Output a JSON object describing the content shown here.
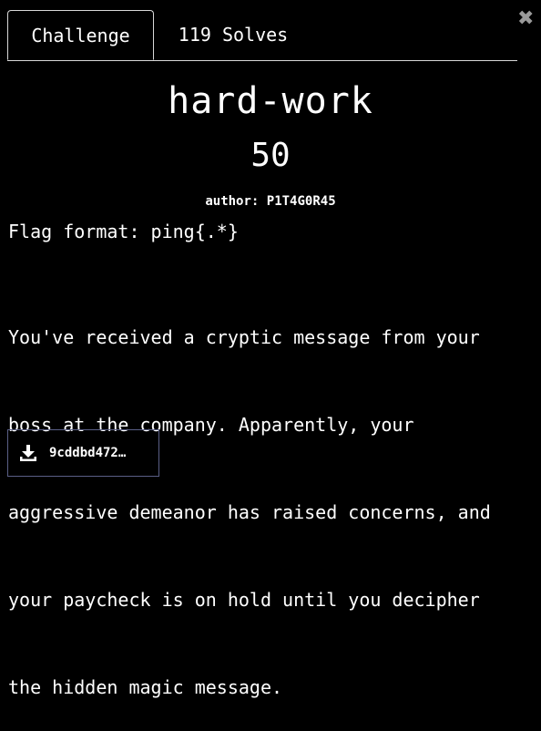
{
  "tabs": {
    "challenge_label": "Challenge",
    "solves_label": "119 Solves"
  },
  "challenge": {
    "name": "hard-work",
    "points": "50",
    "author": "author: P1T4G0R45",
    "flag_format": "Flag format: ping{.*}",
    "description_lines": [
      "You've received a cryptic message from your",
      "boss at the company. Apparently, your",
      "aggressive demeanor has raised concerns, and",
      "your paycheck is on hold until you decipher",
      "the hidden magic message."
    ]
  },
  "file": {
    "name": "9cddbd472…",
    "icon": "download-icon"
  },
  "close_icon": "close-icon",
  "colors": {
    "background": "#000000",
    "text": "#ffffff",
    "border": "#d8d8d8",
    "file_border": "#5a5f86",
    "close": "#9a9a9a"
  }
}
